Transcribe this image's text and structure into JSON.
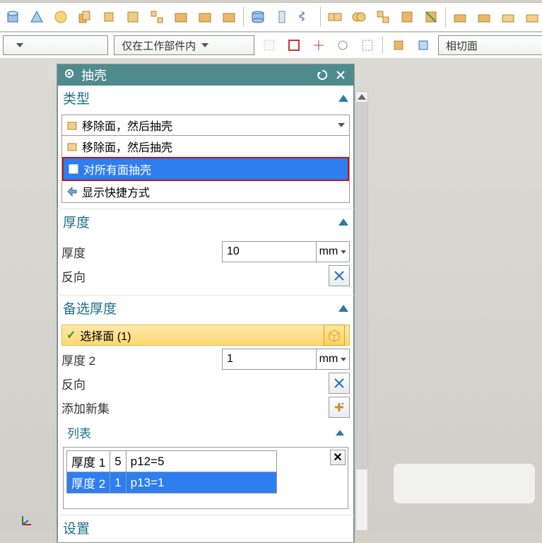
{
  "combo1": {
    "value": ""
  },
  "combo2": {
    "value": "仅在工作部件内"
  },
  "combo3": {
    "value": "相切面"
  },
  "dialog": {
    "title": "抽壳",
    "type": {
      "header": "类型",
      "selected": "移除面，然后抽壳",
      "option_remove": "移除面，然后抽壳",
      "option_allfaces": "对所有面抽壳",
      "option_shortcut": "显示快捷方式"
    },
    "thickness": {
      "header": "厚度",
      "label": "厚度",
      "value": "10",
      "unit": "mm",
      "reverse": "反向"
    },
    "alt": {
      "header": "备选厚度",
      "selectface": "选择面 (1)",
      "t2label": "厚度 2",
      "t2value": "1",
      "t2unit": "mm",
      "reverse": "反向",
      "addset": "添加新集",
      "list_header": "列表",
      "row1": {
        "c1": "厚度 1",
        "c2": "5",
        "c3": "p12=5"
      },
      "row2": {
        "c1": "厚度 2",
        "c2": "1",
        "c3": "p13=1"
      }
    },
    "settings": {
      "header": "设置"
    }
  }
}
